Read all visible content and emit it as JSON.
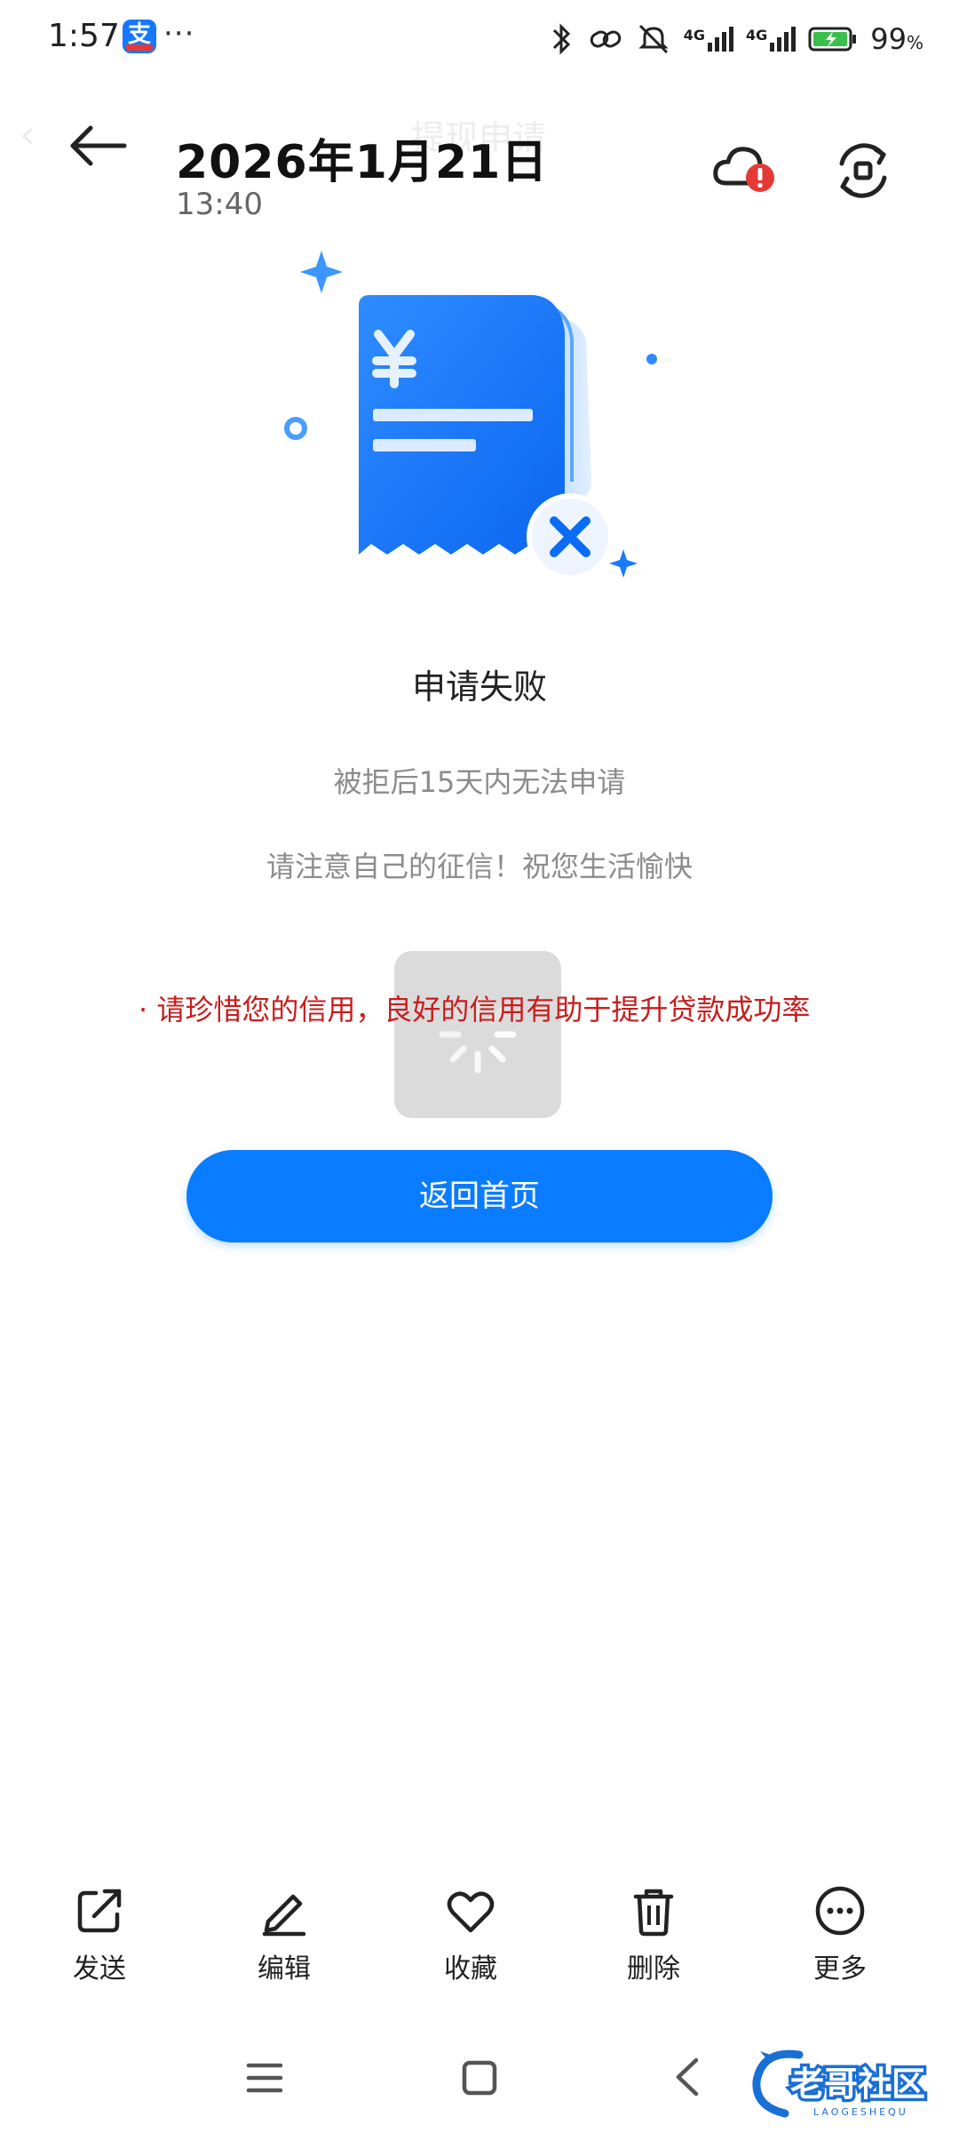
{
  "status_bar": {
    "time": "1:57",
    "app_badge": "支",
    "overflow": "···",
    "network_1": "4G",
    "network_2": "4G",
    "battery_percent": "99",
    "battery_unit": "%"
  },
  "header": {
    "ghost_title": "提现申请",
    "date": "2026年1月21日",
    "time": "13:40",
    "icons": [
      "back-arrow-icon",
      "cloud-warning-icon",
      "rotate-icon"
    ]
  },
  "result": {
    "title": "申请失败",
    "line1": "被拒后15天内无法申请",
    "line2": "请注意自己的征信！祝您生活愉快",
    "note": "· 请珍惜您的信用，良好的信用有助于提升贷款成功率",
    "button": "返回首页"
  },
  "actions": [
    {
      "label": "发送",
      "icon": "share-icon"
    },
    {
      "label": "编辑",
      "icon": "edit-icon"
    },
    {
      "label": "收藏",
      "icon": "heart-icon"
    },
    {
      "label": "删除",
      "icon": "trash-icon"
    },
    {
      "label": "更多",
      "icon": "more-icon"
    }
  ],
  "colors": {
    "accent": "#0a7cff",
    "warning_red": "#c81d1d",
    "muted_text": "#8c8c8c"
  },
  "watermark": {
    "text": "老哥社区",
    "sub": "LAOGESHEQU"
  }
}
